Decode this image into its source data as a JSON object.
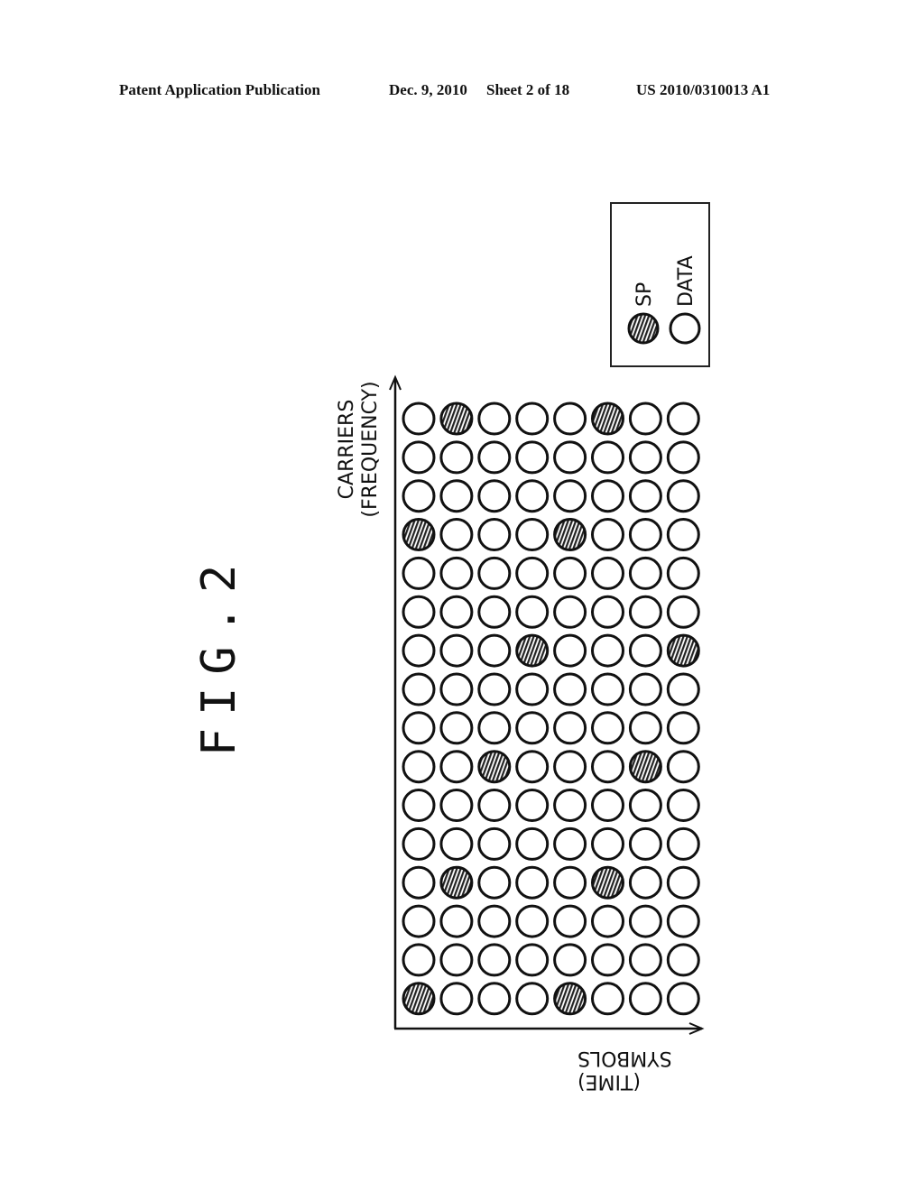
{
  "header": {
    "title": "Patent Application Publication",
    "date": "Dec. 9, 2010",
    "sheet": "Sheet 2 of 18",
    "publication_number": "US 2010/0310013 A1"
  },
  "figure": {
    "label": "FIG.2",
    "y_axis_label_line1": "CARRIERS",
    "y_axis_label_line2": "(FREQUENCY)",
    "x_axis_label_line1": "SYMBOLS",
    "x_axis_label_line2": "(TIME)"
  },
  "legend": {
    "items": [
      {
        "symbol": "hatched-circle",
        "label": "SP"
      },
      {
        "symbol": "open-circle",
        "label": "DATA"
      }
    ]
  },
  "chart_data": {
    "type": "heatmap",
    "title": "FIG.2",
    "xlabel": "SYMBOLS (TIME)",
    "ylabel": "CARRIERS (FREQUENCY)",
    "rows": 16,
    "cols": 8,
    "row_order": "top-to-bottom",
    "legend": [
      "SP",
      "DATA"
    ],
    "cell_types": [
      [
        "DATA",
        "SP",
        "DATA",
        "DATA",
        "DATA",
        "SP",
        "DATA",
        "DATA"
      ],
      [
        "DATA",
        "DATA",
        "DATA",
        "DATA",
        "DATA",
        "DATA",
        "DATA",
        "DATA"
      ],
      [
        "DATA",
        "DATA",
        "DATA",
        "DATA",
        "DATA",
        "DATA",
        "DATA",
        "DATA"
      ],
      [
        "SP",
        "DATA",
        "DATA",
        "DATA",
        "SP",
        "DATA",
        "DATA",
        "DATA"
      ],
      [
        "DATA",
        "DATA",
        "DATA",
        "DATA",
        "DATA",
        "DATA",
        "DATA",
        "DATA"
      ],
      [
        "DATA",
        "DATA",
        "DATA",
        "DATA",
        "DATA",
        "DATA",
        "DATA",
        "DATA"
      ],
      [
        "DATA",
        "DATA",
        "DATA",
        "SP",
        "DATA",
        "DATA",
        "DATA",
        "SP"
      ],
      [
        "DATA",
        "DATA",
        "DATA",
        "DATA",
        "DATA",
        "DATA",
        "DATA",
        "DATA"
      ],
      [
        "DATA",
        "DATA",
        "DATA",
        "DATA",
        "DATA",
        "DATA",
        "DATA",
        "DATA"
      ],
      [
        "DATA",
        "DATA",
        "SP",
        "DATA",
        "DATA",
        "DATA",
        "SP",
        "DATA"
      ],
      [
        "DATA",
        "DATA",
        "DATA",
        "DATA",
        "DATA",
        "DATA",
        "DATA",
        "DATA"
      ],
      [
        "DATA",
        "DATA",
        "DATA",
        "DATA",
        "DATA",
        "DATA",
        "DATA",
        "DATA"
      ],
      [
        "DATA",
        "SP",
        "DATA",
        "DATA",
        "DATA",
        "SP",
        "DATA",
        "DATA"
      ],
      [
        "DATA",
        "DATA",
        "DATA",
        "DATA",
        "DATA",
        "DATA",
        "DATA",
        "DATA"
      ],
      [
        "DATA",
        "DATA",
        "DATA",
        "DATA",
        "DATA",
        "DATA",
        "DATA",
        "DATA"
      ],
      [
        "SP",
        "DATA",
        "DATA",
        "DATA",
        "SP",
        "DATA",
        "DATA",
        "DATA"
      ]
    ]
  }
}
